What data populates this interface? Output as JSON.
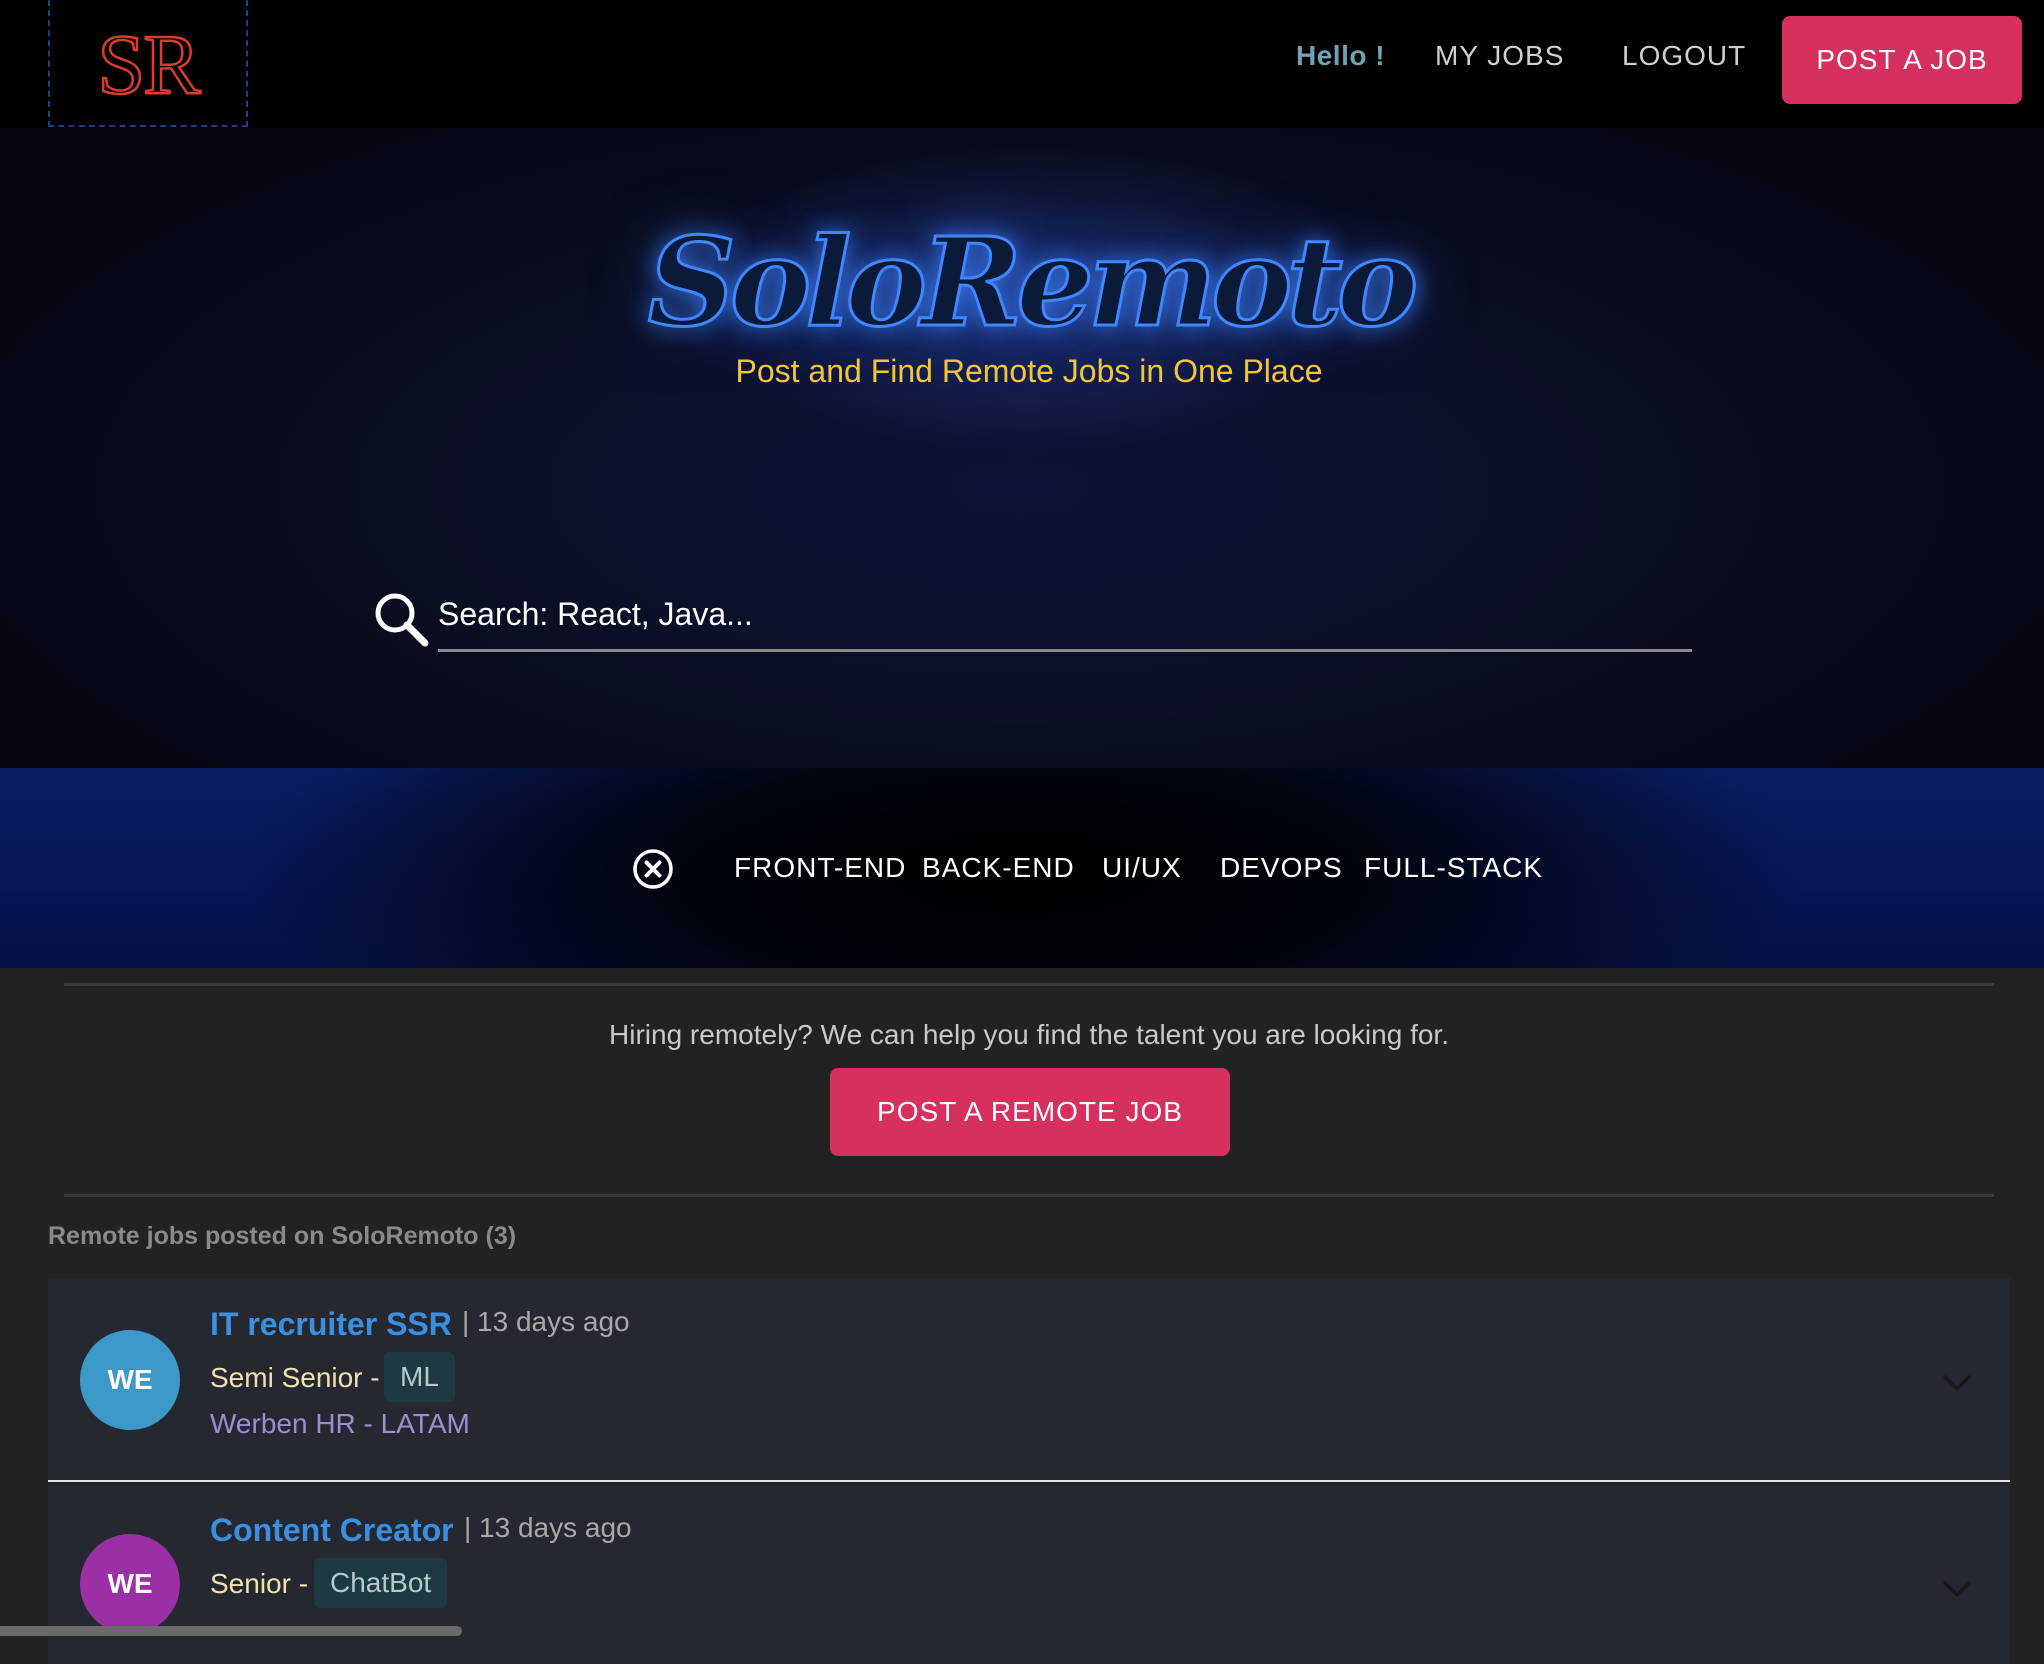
{
  "nav": {
    "logo_text": "SR",
    "greeting": "Hello !",
    "my_jobs": "MY JOBS",
    "logout": "LOGOUT",
    "post_job": "POST A JOB"
  },
  "hero": {
    "title": "SoloRemoto",
    "subtitle": "Post and Find Remote Jobs in One Place",
    "search_placeholder": "Search: React, Java..."
  },
  "categories": [
    "FRONT-END",
    "BACK-END",
    "UI/UX",
    "DEVOPS",
    "FULL-STACK"
  ],
  "hiring": {
    "text": "Hiring remotely? We can help you find the talent you are looking for.",
    "button": "POST A REMOTE JOB"
  },
  "jobs_header": "Remote jobs posted on SoloRemoto (3)",
  "jobs": [
    {
      "initials": "WE",
      "avatar_color": "#3d97c9",
      "title": "IT recruiter SSR",
      "age": "| 13 days ago",
      "level": "Semi Senior -",
      "tag": "ML",
      "company": "Werben HR - LATAM"
    },
    {
      "initials": "WE",
      "avatar_color": "#9a2fa6",
      "title": "Content Creator",
      "age": "| 13 days ago",
      "level": "Senior -",
      "tag": "ChatBot",
      "company": ""
    }
  ],
  "colors": {
    "accent": "#d6305e",
    "title_blue": "#3b8fe0",
    "subtitle_gold": "#f3c63a"
  }
}
